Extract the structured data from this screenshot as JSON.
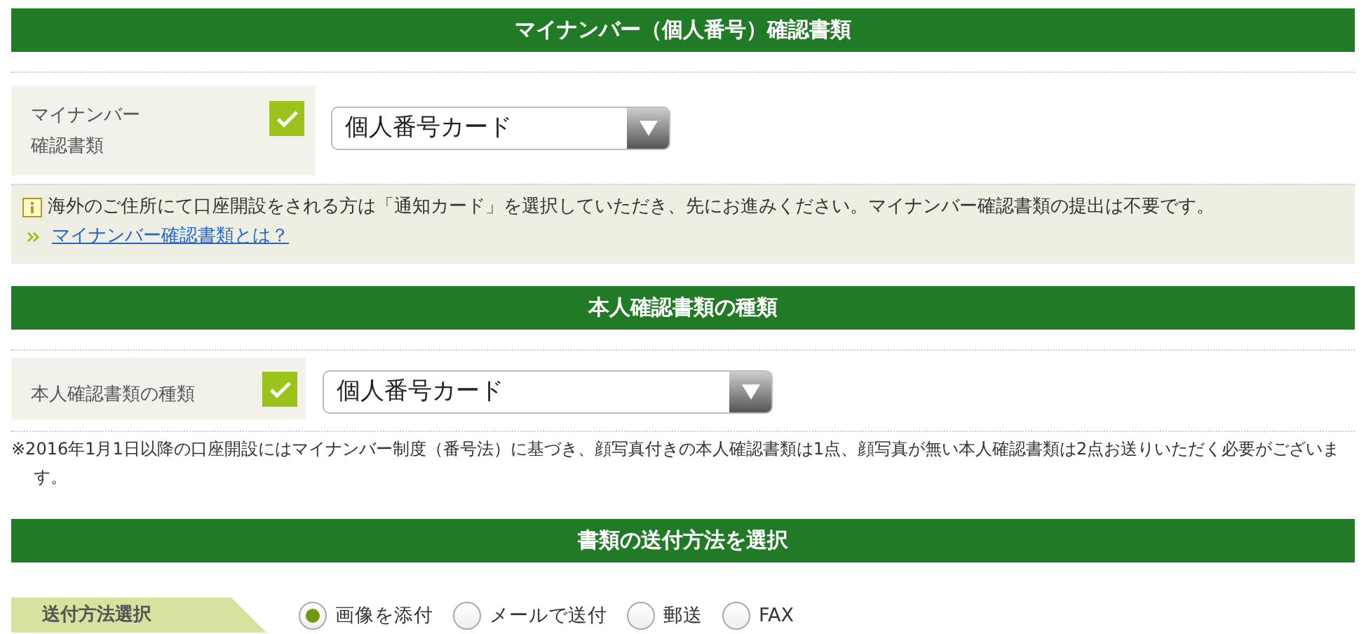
{
  "mynumber_section": {
    "heading": "マイナンバー（個人番号）確認書類",
    "field": {
      "label_lines": [
        "マイナンバー",
        "確認書類"
      ],
      "checked": true,
      "value": "個人番号カード"
    },
    "notice": {
      "text": "海外のご住所にて口座開設をされる方は「通知カード」を選択していただき、先にお進みください。マイナンバー確認書類の提出は不要です。",
      "link": "マイナンバー確認書類とは？"
    }
  },
  "identity_section": {
    "heading": "本人確認書類の種類",
    "field": {
      "label_lines": [
        "本人確認書類の種類"
      ],
      "checked": true,
      "value": "個人番号カード"
    },
    "note": "※2016年1月1日以降の口座開設にはマイナンバー制度（番号法）に基づき、顔写真付きの本人確認書類は1点、顔写真が無い本人確認書類は2点お送りいただく必要がございます。"
  },
  "delivery_section": {
    "heading": "書類の送付方法を選択",
    "label": "送付方法選択",
    "options": [
      {
        "label": "画像を添付",
        "selected": true
      },
      {
        "label": "メールで送付",
        "selected": false
      },
      {
        "label": "郵送",
        "selected": false
      },
      {
        "label": "FAX",
        "selected": false
      }
    ]
  }
}
